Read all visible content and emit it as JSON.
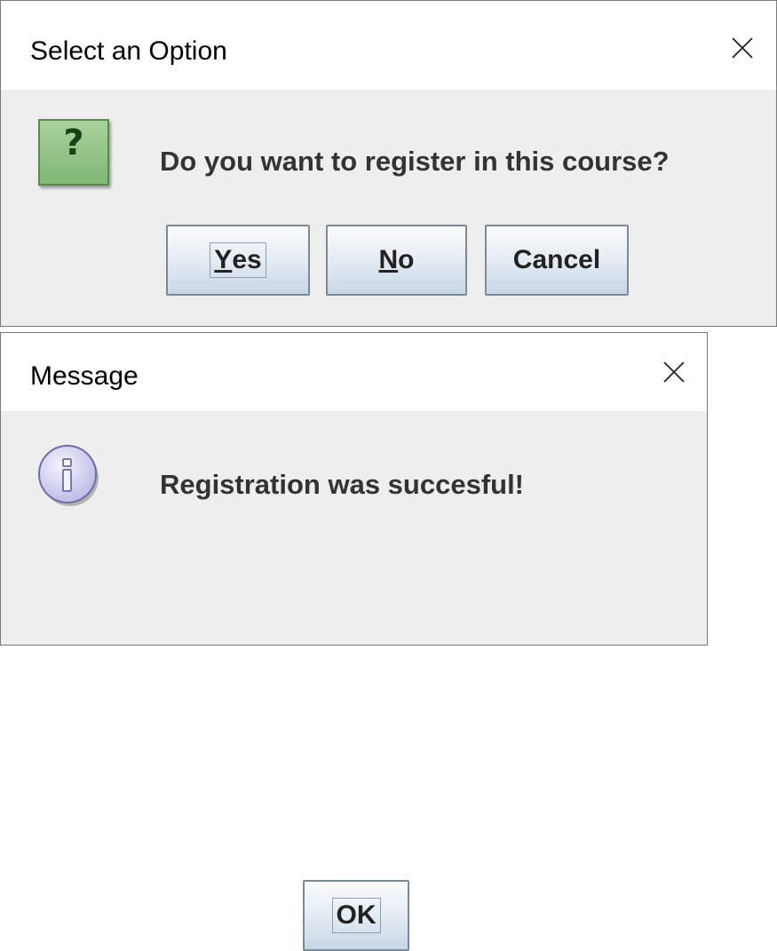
{
  "dialogs": [
    {
      "title": "Select an Option",
      "icon": "question-icon",
      "icon_glyph": "?",
      "message": "Do you want to register in this course?",
      "buttons": [
        {
          "mnemonic": "Y",
          "rest": "es",
          "focused": true
        },
        {
          "mnemonic": "N",
          "rest": "o",
          "focused": false
        },
        {
          "label": "Cancel",
          "focused": false
        }
      ]
    },
    {
      "title": "Message",
      "icon": "info-icon",
      "icon_glyph": "i",
      "message": "Registration was succesful!",
      "buttons": [
        {
          "label": "OK",
          "focused": true
        }
      ]
    }
  ],
  "colors": {
    "dialog_bg": "#eeeeee",
    "titlebar_bg": "#ffffff",
    "question_icon_bg": "#8fc484",
    "info_icon_bg": "#cfcfee",
    "text": "#333333"
  }
}
